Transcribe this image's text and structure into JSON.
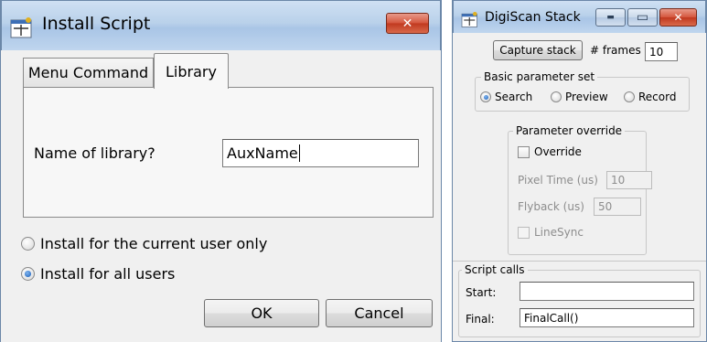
{
  "install_dialog": {
    "title": "Install Script",
    "close_glyph": "✕",
    "tabs": [
      {
        "label": "Menu Command",
        "active": false
      },
      {
        "label": "Library",
        "active": true
      }
    ],
    "library_label": "Name of library?",
    "library_value": "AuxName",
    "radio_options": [
      {
        "label": "Install for the current user only",
        "checked": false
      },
      {
        "label": "Install for all users",
        "checked": true
      }
    ],
    "ok_label": "OK",
    "cancel_label": "Cancel"
  },
  "digiscan": {
    "title": "DigiScan Stack",
    "minimize_glyph": "▬",
    "maximize_glyph": "▭",
    "close_glyph": "✕",
    "capture_label": "Capture stack",
    "frames_label": "# frames",
    "frames_value": "10",
    "basic_group_title": "Basic parameter set",
    "basic_options": [
      {
        "label": "Search",
        "checked": true
      },
      {
        "label": "Preview",
        "checked": false
      },
      {
        "label": "Record",
        "checked": false
      }
    ],
    "override_group_title": "Parameter override",
    "override_label": "Override",
    "pixel_time_label": "Pixel Time (us)",
    "pixel_time_value": "10",
    "flyback_label": "Flyback (us)",
    "flyback_value": "50",
    "linesync_label": "LineSync",
    "script_group_title": "Script calls",
    "start_label": "Start:",
    "start_value": "",
    "final_label": "Final:",
    "final_value": "FinalCall()"
  },
  "icons": {
    "app_icon": "script-window-icon",
    "accent_close": "#c9432a",
    "radio_selected": "#1b5fb9"
  }
}
